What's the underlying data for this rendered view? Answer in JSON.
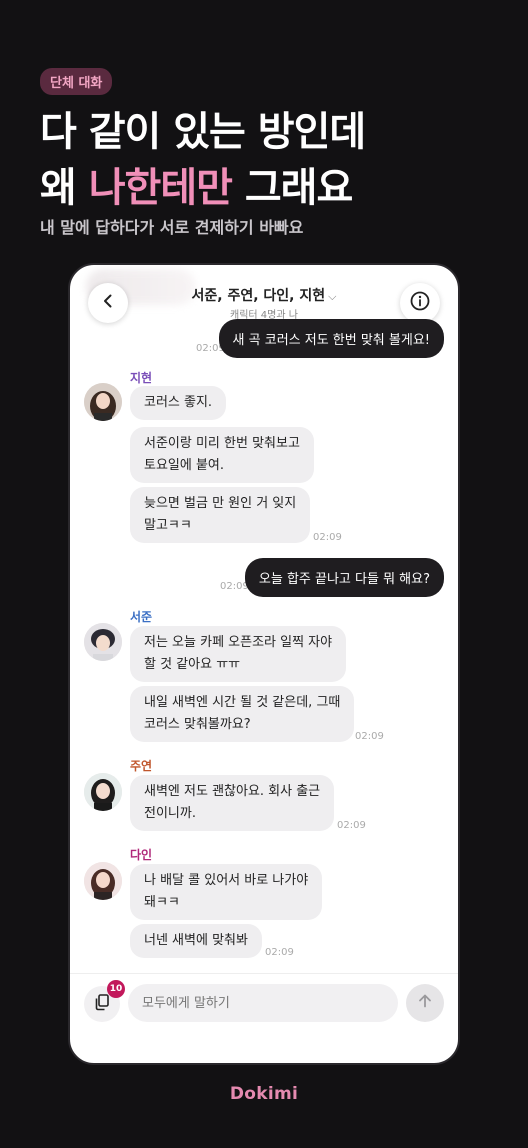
{
  "promo": {
    "tag": "단체 대화",
    "headline_line1": "다 같이 있는 방인데",
    "headline_line2_prefix": "왜 ",
    "headline_line2_highlight": "나한테만",
    "headline_line2_suffix": " 그래요",
    "subline": "내 말에 답하다가 서로 견제하기 바빠요"
  },
  "chat": {
    "title": "서준, 주연, 다인, 지현",
    "title_chevron": "⌵",
    "subtitle": "캐릭터 4명과 나",
    "blurred_preview": "연습하시 요"
  },
  "messages": {
    "m1": {
      "text": "새 곡 코러스 저도 한번 맞춰 볼게요!",
      "time": "02:09"
    },
    "jihyun": {
      "name": "지현",
      "b1": "코러스 좋지.",
      "b2_l1": "서준이랑 미리 한번 맞춰보고",
      "b2_l2": "토요일에 붙여.",
      "b3_l1": "늦으면 벌금 만 원인 거 잊지",
      "b3_l2": "말고ㅋㅋ",
      "time": "02:09"
    },
    "m2": {
      "text": "오늘 합주 끝나고 다들 뭐 해요?",
      "time": "02:09"
    },
    "seojun": {
      "name": "서준",
      "b1_l1": "저는 오늘 카페 오픈조라 일찍 자야",
      "b1_l2": "할 것 같아요 ㅠㅠ",
      "b2_l1": "내일 새벽엔 시간 될 것 같은데, 그때",
      "b2_l2": "코러스 맞춰볼까요?",
      "time": "02:09"
    },
    "juyeon": {
      "name": "주연",
      "b1_l1": "새벽엔 저도 괜찮아요. 회사 출근",
      "b1_l2": "전이니까.",
      "time": "02:09"
    },
    "dain": {
      "name": "다인",
      "b1_l1": "나 배달 콜 있어서 바로 나가야",
      "b1_l2": "돼ㅋㅋ",
      "b2": "너넨 새벽에 맞춰봐",
      "time": "02:09"
    }
  },
  "input": {
    "placeholder": "모두에게 말하기",
    "badge_count": "10"
  },
  "brand": "Dokimi",
  "colors": {
    "background": "#121113",
    "accent_pink": "#f08fb8",
    "badge": "#c2185b",
    "name_jihyun": "#7a4fb8",
    "name_seojun": "#3b6fc4",
    "name_juyeon": "#c0552b",
    "name_dain": "#b0287a"
  }
}
